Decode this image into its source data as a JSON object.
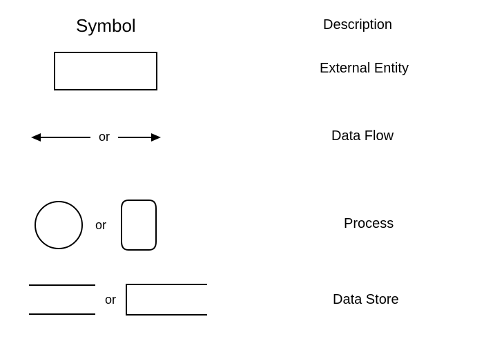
{
  "headers": {
    "symbol": "Symbol",
    "description": "Description"
  },
  "rows": {
    "external_entity": {
      "description": "External Entity"
    },
    "data_flow": {
      "or": "or",
      "description": "Data Flow"
    },
    "process": {
      "or": "or",
      "description": "Process"
    },
    "data_store": {
      "or": "or",
      "description": "Data Store"
    }
  }
}
